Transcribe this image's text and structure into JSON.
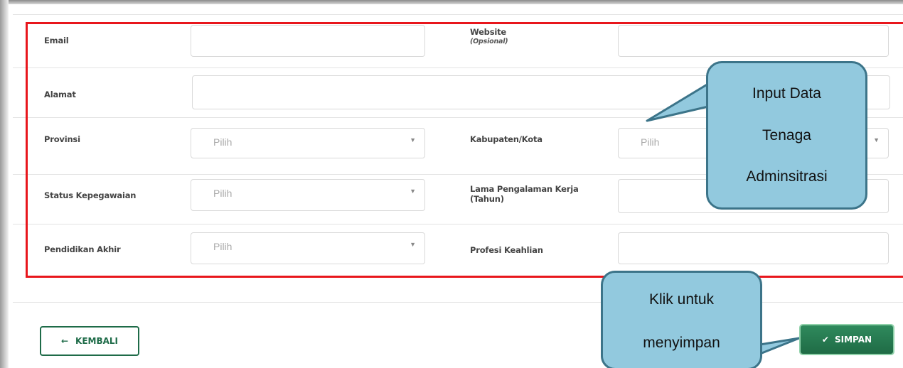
{
  "form": {
    "email": {
      "label": "Email",
      "value": ""
    },
    "website": {
      "label": "Website",
      "sublabel": "(Opsional)",
      "value": ""
    },
    "alamat": {
      "label": "Alamat",
      "value": ""
    },
    "provinsi": {
      "label": "Provinsi",
      "placeholder": "Pilih"
    },
    "kabupaten": {
      "label": "Kabupaten/Kota",
      "placeholder": "Pilih"
    },
    "status": {
      "label": "Status Kepegawaian",
      "placeholder": "Pilih"
    },
    "lama": {
      "label": "Lama Pengalaman Kerja",
      "sublabel": "(Tahun)",
      "value": ""
    },
    "pendidikan": {
      "label": "Pendidikan Akhir",
      "placeholder": "Pilih"
    },
    "profesi": {
      "label": "Profesi Keahlian",
      "value": ""
    }
  },
  "callouts": {
    "input": {
      "line1": "Input Data",
      "line2": "Tenaga",
      "line3": "Adminsitrasi"
    },
    "save": {
      "line1": "Klik untuk",
      "line2": "menyimpan"
    }
  },
  "buttons": {
    "back_label": "KEMBALI",
    "back_icon": "←",
    "save_label": "SIMPAN",
    "save_icon": "✔"
  },
  "colors": {
    "highlight": "#e8161c",
    "primary": "#1f6b45",
    "callout_fill": "#92c9de",
    "callout_border": "#3c7489"
  }
}
